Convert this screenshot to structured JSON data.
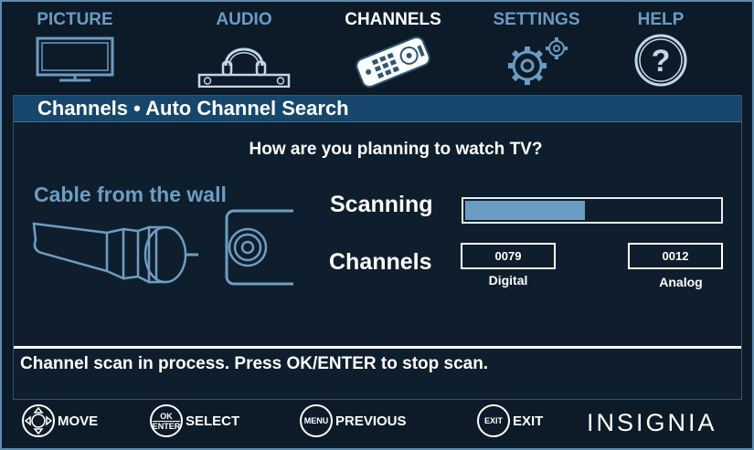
{
  "tabs": [
    {
      "label": "PICTURE",
      "icon": "tv-icon",
      "active": false
    },
    {
      "label": "AUDIO",
      "icon": "headphones-icon",
      "active": false
    },
    {
      "label": "CHANNELS",
      "icon": "remote-icon",
      "active": true
    },
    {
      "label": "SETTINGS",
      "icon": "gears-icon",
      "active": false
    },
    {
      "label": "HELP",
      "icon": "question-icon",
      "active": false
    }
  ],
  "panel": {
    "title": "Channels • Auto Channel Search",
    "question": "How are you planning to watch TV?",
    "source_label": "Cable from the wall",
    "scanning_label": "Scanning",
    "scan_progress": 0.47,
    "channels_label": "Channels",
    "digital": {
      "count": "0079",
      "caption": "Digital"
    },
    "analog": {
      "count": "0012",
      "caption": "Analog"
    },
    "status": "Channel scan in process. Press OK/ENTER to stop scan."
  },
  "footer": {
    "move": {
      "icon": "dpad-icon",
      "label": "MOVE"
    },
    "select": {
      "icon_text_top": "OK",
      "icon_text_bottom": "ENTER",
      "label": "SELECT"
    },
    "previous": {
      "icon_text": "MENU",
      "label": "PREVIOUS"
    },
    "exit": {
      "icon_text": "EXIT",
      "label": "EXIT"
    },
    "brand": "INSIGNIA"
  },
  "colors": {
    "background": "#0d1b29",
    "accent": "#6a9cc3",
    "title_bar": "#16466b",
    "text": "#ffffff"
  }
}
